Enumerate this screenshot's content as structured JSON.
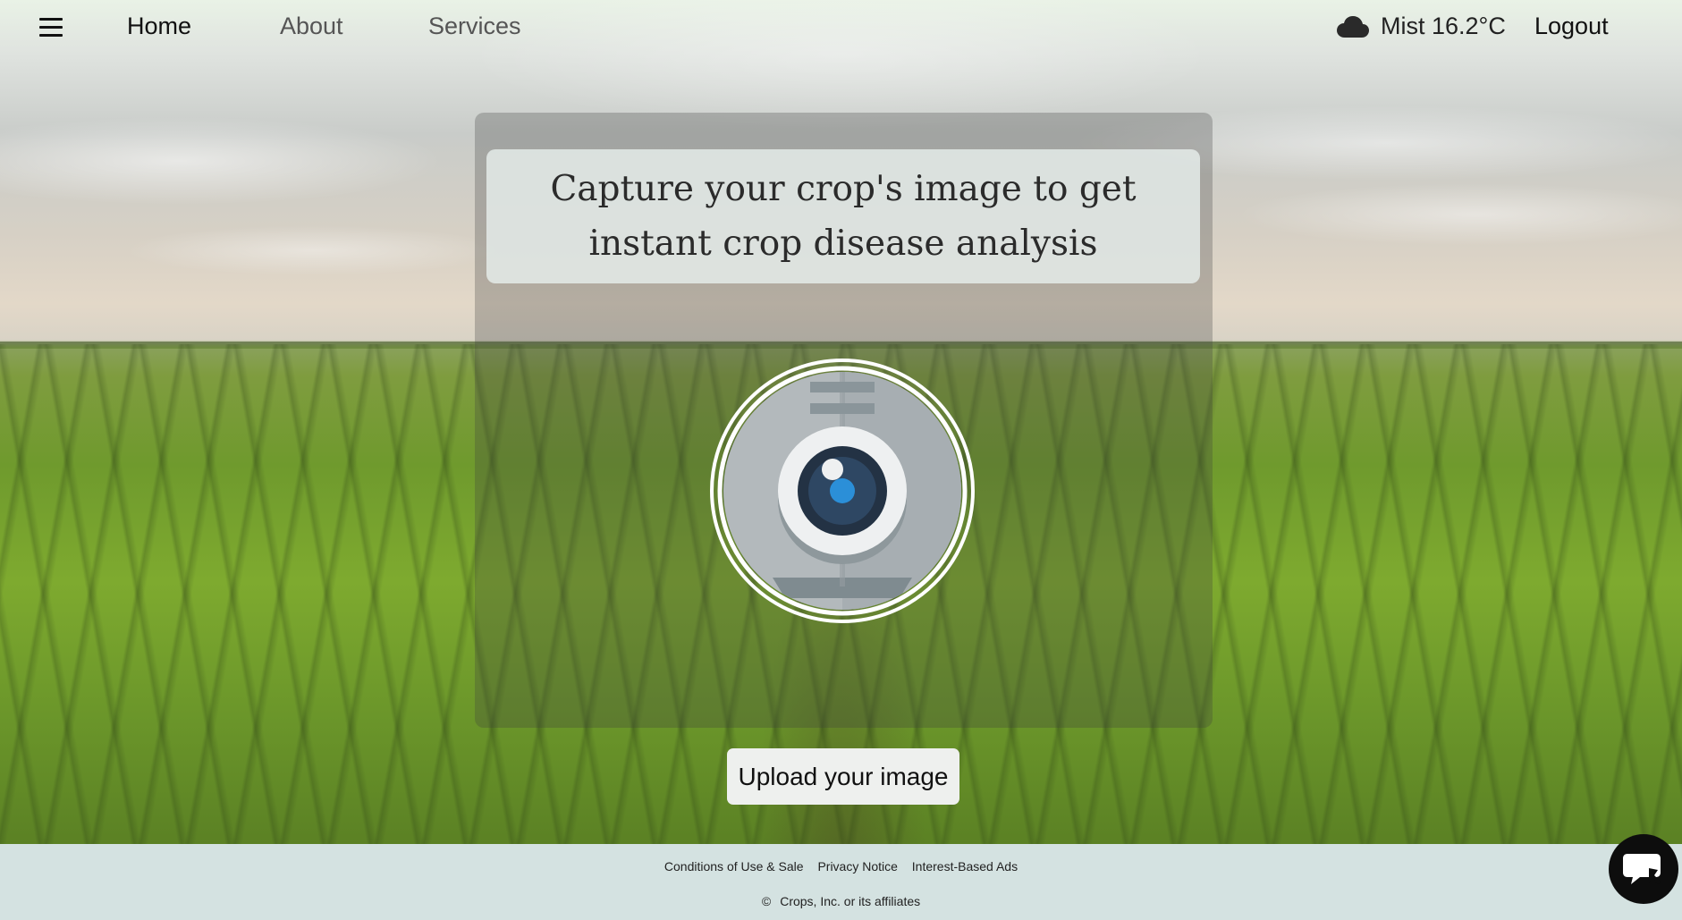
{
  "nav": {
    "home": "Home",
    "about": "About",
    "services": "Services",
    "weather": "Mist 16.2°C",
    "logout": "Logout",
    "menu_icon": "hamburger-menu-icon",
    "weather_icon": "cloud-icon"
  },
  "main": {
    "headline": "Capture your crop's image to get instant crop disease analysis",
    "camera_icon": "webcam-icon",
    "upload_label": "Upload your image"
  },
  "footer": {
    "links": [
      "Conditions of Use & Sale",
      "Privacy Notice",
      "Interest-Based Ads"
    ],
    "copyright_symbol": "©",
    "copyright": "Crops, Inc. or its affiliates"
  },
  "chat": {
    "icon": "chat-icon"
  },
  "colors": {
    "footer_bg": "#d4e2e1",
    "chat_bg": "#0d0d0d",
    "lens_blue": "#2b8fd8"
  }
}
